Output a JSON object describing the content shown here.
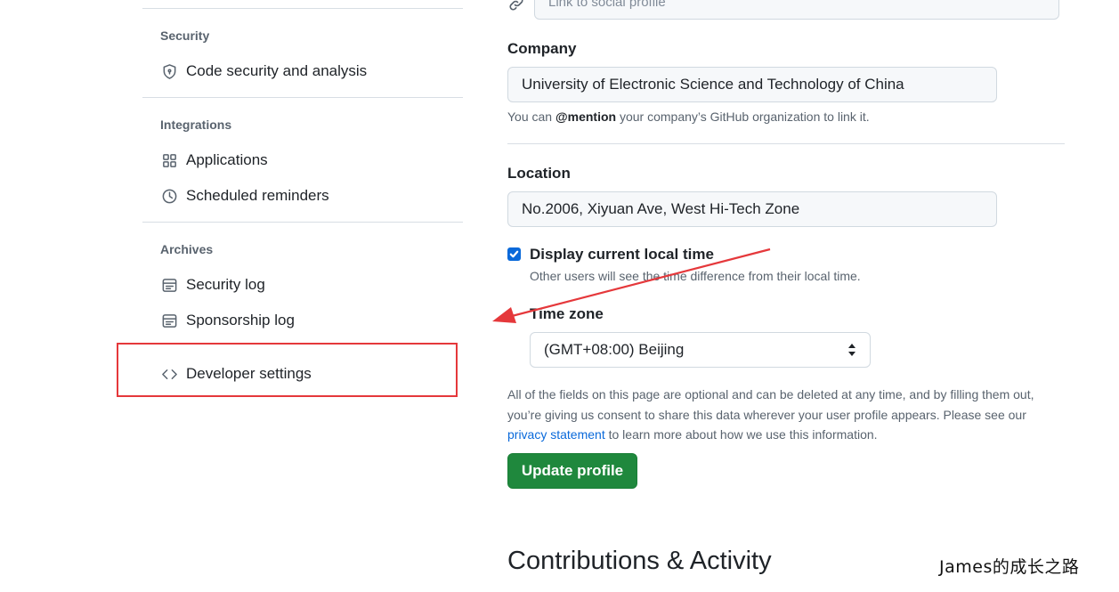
{
  "sidebar": {
    "groups": [
      {
        "title": "Security",
        "items": [
          {
            "label": "Code security and analysis",
            "icon": "shield-icon"
          }
        ]
      },
      {
        "title": "Integrations",
        "items": [
          {
            "label": "Applications",
            "icon": "apps-grid-icon"
          },
          {
            "label": "Scheduled reminders",
            "icon": "clock-icon"
          }
        ]
      },
      {
        "title": "Archives",
        "items": [
          {
            "label": "Security log",
            "icon": "log-icon"
          },
          {
            "label": "Sponsorship log",
            "icon": "log-icon"
          }
        ]
      }
    ],
    "developer_settings": {
      "label": "Developer settings",
      "icon": "code-icon"
    }
  },
  "form": {
    "social_placeholder": "Link to social profile",
    "company": {
      "label": "Company",
      "value": "University of Electronic Science and Technology of China",
      "note_prefix": "You can ",
      "note_mention": "@mention",
      "note_suffix": " your company’s GitHub organization to link it."
    },
    "location": {
      "label": "Location",
      "value": "No.2006, Xiyuan Ave, West Hi-Tech Zone"
    },
    "local_time": {
      "label": "Display current local time",
      "checked": true,
      "note": "Other users will see the time difference from their local time."
    },
    "timezone": {
      "label": "Time zone",
      "value": "(GMT+08:00) Beijing"
    },
    "disclaimer": {
      "before": "All of the fields on this page are optional and can be deleted at any time, and by filling them out, you’re giving us consent to share this data wherever your user profile appears. Please see our ",
      "link": "privacy statement",
      "after": " to learn more about how we use this information."
    },
    "update_button": "Update profile"
  },
  "contributions_heading": "Contributions & Activity",
  "watermark": "James的成长之路",
  "colors": {
    "accent": "#0969da",
    "primary_button": "#1f883d",
    "annotation": "#e5383b"
  }
}
